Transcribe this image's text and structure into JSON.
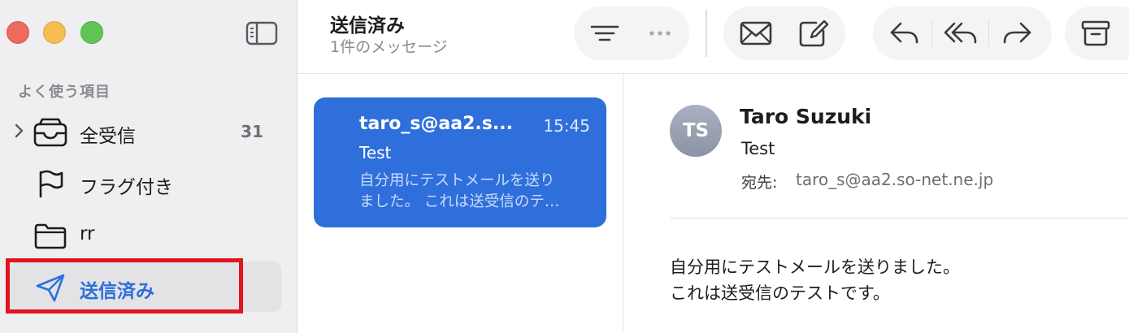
{
  "sidebar": {
    "section_header": "よく使う項目",
    "items": [
      {
        "label": "全受信",
        "count": "31"
      },
      {
        "label": "フラグ付き"
      },
      {
        "label": "rr"
      },
      {
        "label": "送信済み"
      }
    ]
  },
  "toolbar": {
    "title": "送信済み",
    "subtitle": "1件のメッセージ"
  },
  "message_list": {
    "items": [
      {
        "sender": "taro_s@aa2.s...",
        "time": "15:45",
        "subject": "Test",
        "preview_line1": "自分用にテストメールを送り",
        "preview_line2": "ました。 これは送受信のテ…"
      }
    ]
  },
  "reader": {
    "avatar_initials": "TS",
    "from_name": "Taro Suzuki",
    "subject": "Test",
    "to_label": "宛先:",
    "to_value": "taro_s@aa2.so-net.ne.jp",
    "body_lines": [
      "自分用にテストメールを送りました。",
      "これは送受信のテストです。"
    ]
  },
  "colors": {
    "accent": "#2f6fdc",
    "highlight": "#e0141e"
  },
  "icons": [
    "sidebar-toggle-icon",
    "chevron-right-icon",
    "inbox-tray-icon",
    "flag-icon",
    "folder-icon",
    "paper-plane-icon",
    "filter-icon",
    "more-icon",
    "envelope-icon",
    "compose-icon",
    "reply-icon",
    "reply-all-icon",
    "forward-icon",
    "archive-icon"
  ]
}
